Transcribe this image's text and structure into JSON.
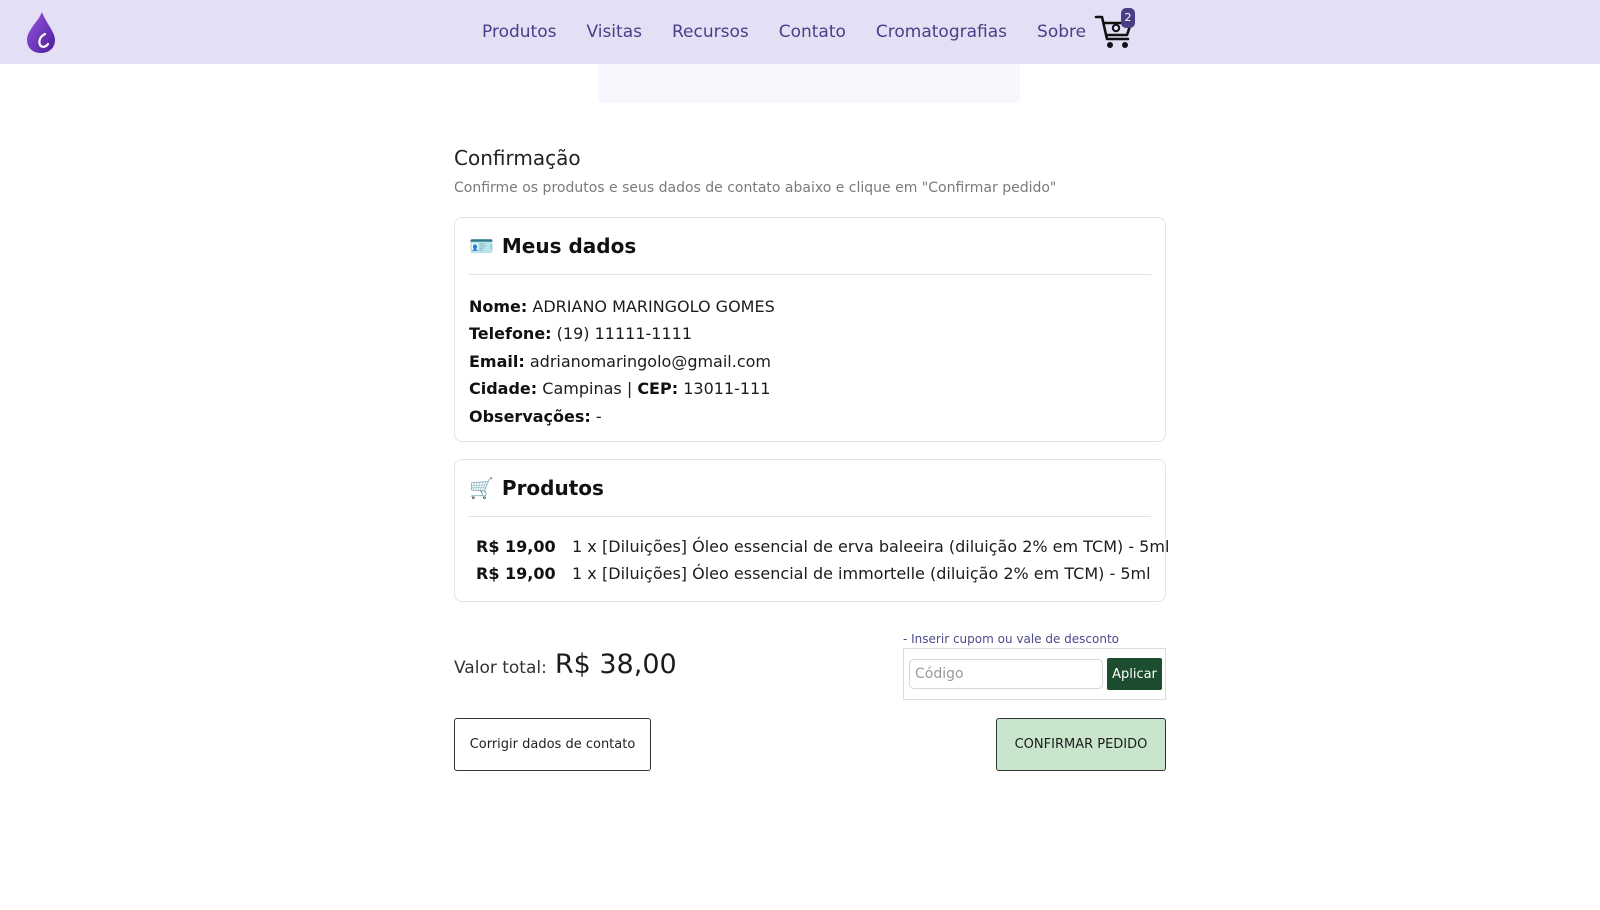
{
  "navbar": {
    "logo_icon": "purple-drop-logo",
    "links": [
      "Produtos",
      "Visitas",
      "Recursos",
      "Contato",
      "Cromatografias",
      "Sobre"
    ],
    "cart_icon": "shopping-cart-icon",
    "cart_count": "2"
  },
  "page": {
    "title": "Confirmação",
    "subtitle": "Confirme os produtos e seus dados de contato abaixo e clique em \"Confirmar pedido\""
  },
  "my_data": {
    "icon": "id-card-icon",
    "emoji": "🪪",
    "title": "Meus dados",
    "name_label": "Nome:",
    "name": "ADRIANO MARINGOLO GOMES",
    "phone_label": "Telefone:",
    "phone": "(19) 11111-1111",
    "email_label": "Email:",
    "email": "adrianomaringolo@gmail.com",
    "city_label": "Cidade:",
    "city": "Campinas",
    "separator": "|",
    "cep_label": "CEP:",
    "cep": "13011-111",
    "notes_label": "Observações:",
    "notes": "-"
  },
  "products": {
    "icon": "shopping-cart-icon",
    "emoji": "🛒",
    "title": "Produtos",
    "items": [
      {
        "price": "R$ 19,00",
        "qty": "1 x",
        "name": "[Diluições] Óleo essencial de erva baleeira (diluição 2% em TCM) - 5ml"
      },
      {
        "price": "R$ 19,00",
        "qty": "1 x",
        "name": "[Diluições] Óleo essencial de immortelle (diluição 2% em TCM) - 5ml"
      }
    ]
  },
  "total": {
    "label": "Valor total:",
    "value": "R$ 38,00"
  },
  "coupon": {
    "link": "- Inserir cupom ou vale de desconto",
    "placeholder": "Código",
    "value": "",
    "apply_label": "Aplicar"
  },
  "actions": {
    "edit_label": "Corrigir dados de contato",
    "confirm_label": "CONFIRMAR PEDIDO"
  },
  "colors": {
    "navbar_bg": "#e3e0f6",
    "nav_text": "#4b3d86",
    "apply_bg": "#1c4d2e",
    "confirm_bg": "#c9e6cd"
  }
}
